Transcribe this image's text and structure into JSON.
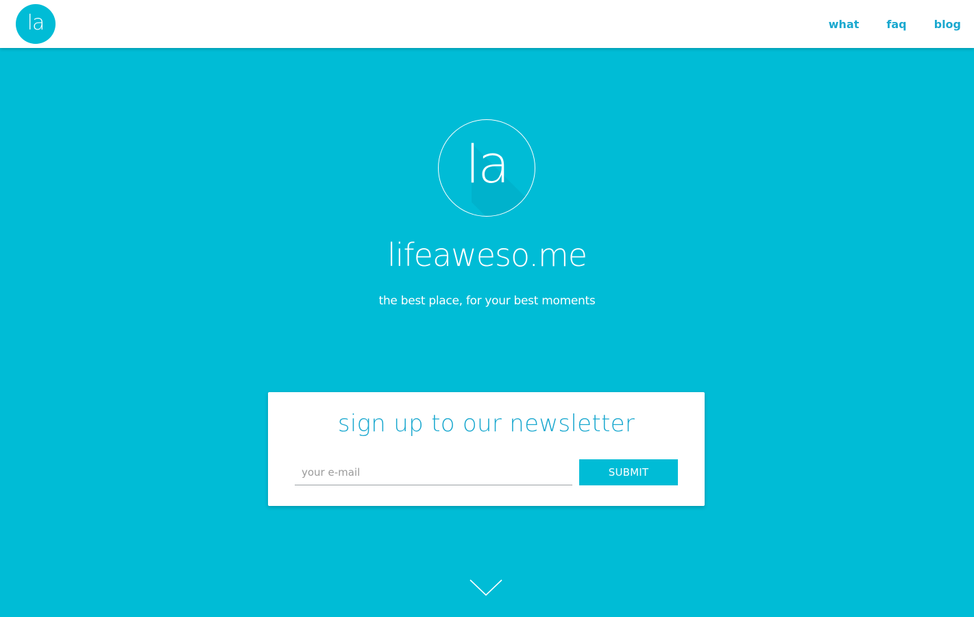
{
  "colors": {
    "brand": "#00bcd6",
    "link": "#1aa8cf",
    "white": "#ffffff"
  },
  "nav": {
    "logo_text": "la",
    "links": [
      {
        "label": "what"
      },
      {
        "label": "faq"
      },
      {
        "label": "blog"
      }
    ]
  },
  "hero": {
    "logo_text": "la",
    "title": "lifeaweso.me",
    "tagline": "the best place, for your best moments"
  },
  "newsletter": {
    "heading": "sign up to our newsletter",
    "email_placeholder": "your e-mail",
    "email_value": "",
    "submit_label": "SUBMIT"
  },
  "icons": {
    "scroll": "chevron-down-icon"
  }
}
